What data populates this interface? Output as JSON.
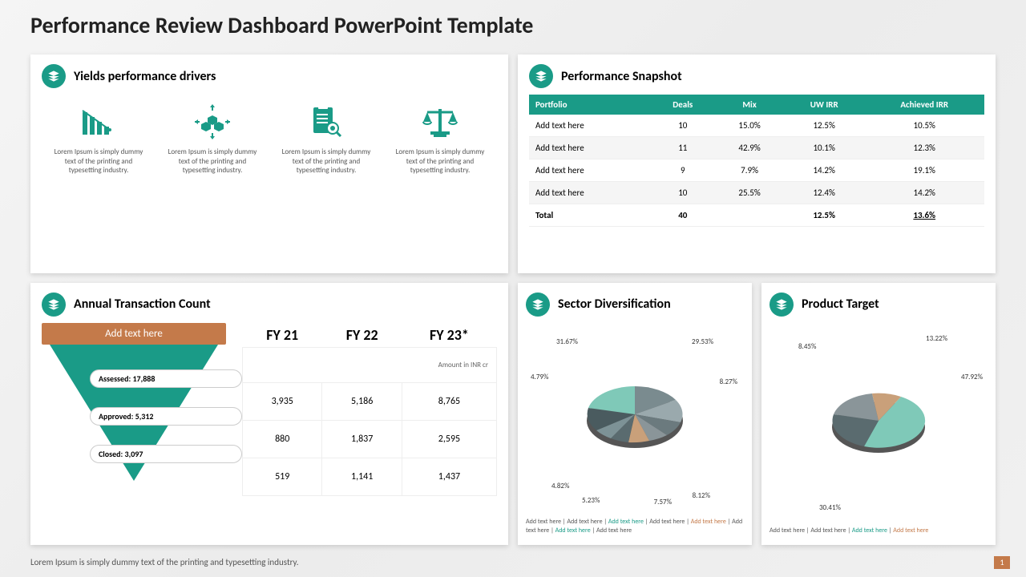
{
  "title": "Performance Review Dashboard PowerPoint Template",
  "footer": "Lorem Ipsum is simply dummy text of the printing and typesetting industry.",
  "page_num": "1",
  "drivers": {
    "title": "Yields performance drivers",
    "items": [
      {
        "text": "Lorem Ipsum is simply dummy text of the printing and typesetting industry."
      },
      {
        "text": "Lorem Ipsum is simply dummy text of the printing and typesetting industry."
      },
      {
        "text": "Lorem Ipsum is simply dummy text of the printing and typesetting industry."
      },
      {
        "text": "Lorem Ipsum is simply dummy text of the printing and typesetting industry."
      }
    ]
  },
  "snapshot": {
    "title": "Performance Snapshot",
    "headers": [
      "Portfolio",
      "Deals",
      "Mix",
      "UW IRR",
      "Achieved IRR"
    ],
    "rows": [
      {
        "portfolio": "Add text here",
        "deals": "10",
        "mix": "15.0%",
        "uw": "12.5%",
        "ach": "10.5%"
      },
      {
        "portfolio": "Add text here",
        "deals": "11",
        "mix": "42.9%",
        "uw": "10.1%",
        "ach": "12.3%"
      },
      {
        "portfolio": "Add text here",
        "deals": "9",
        "mix": "7.9%",
        "uw": "14.2%",
        "ach": "19.1%"
      },
      {
        "portfolio": "Add text here",
        "deals": "10",
        "mix": "25.5%",
        "uw": "12.4%",
        "ach": "14.2%"
      }
    ],
    "total": {
      "portfolio": "Total",
      "deals": "40",
      "mix": "",
      "uw": "12.5%",
      "ach": "13.6%"
    }
  },
  "annual": {
    "title": "Annual Transaction Count",
    "funnel_top": "Add text here",
    "stages": [
      {
        "label": "Assessed:",
        "value": "17,888"
      },
      {
        "label": "Approved:",
        "value": "5,312"
      },
      {
        "label": "Closed:",
        "value": "3,097"
      }
    ],
    "years": [
      "FY 21",
      "FY 22",
      "FY 23*"
    ],
    "subhead": "Amount in INR  cr",
    "rows": [
      [
        "3,935",
        "5,186",
        "8,765"
      ],
      [
        "880",
        "1,837",
        "2,595"
      ],
      [
        "519",
        "1,141",
        "1,437"
      ]
    ]
  },
  "sector": {
    "title": "Sector Diversification",
    "legend": "Add text here | Add text here | Add text here | Add text here | Add text here | Add text here | Add text here | Add text here",
    "labels": [
      "31.67%",
      "29.53%",
      "8.27%",
      "8.12%",
      "7.57%",
      "5.23%",
      "4.82%",
      "4.79%"
    ]
  },
  "product": {
    "title": "Product Target",
    "legend": "Add text here | Add text here | Add text here | Add text here",
    "labels": [
      "13.22%",
      "8.45%",
      "47.92%",
      "30.41%"
    ]
  },
  "chart_data": [
    {
      "type": "pie",
      "title": "Sector Diversification",
      "series": [
        {
          "name": "Sector",
          "values": [
            31.67,
            29.53,
            8.27,
            8.12,
            7.57,
            5.23,
            4.82,
            4.79
          ]
        }
      ],
      "categories": [
        "Add text here",
        "Add text here",
        "Add text here",
        "Add text here",
        "Add text here",
        "Add text here",
        "Add text here",
        "Add text here"
      ]
    },
    {
      "type": "pie",
      "title": "Product Target",
      "series": [
        {
          "name": "Product",
          "values": [
            47.92,
            30.41,
            13.22,
            8.45
          ]
        }
      ],
      "categories": [
        "Add text here",
        "Add text here",
        "Add text here",
        "Add text here"
      ]
    },
    {
      "type": "table",
      "title": "Annual Transaction Count",
      "categories": [
        "FY 21",
        "FY 22",
        "FY 23*"
      ],
      "series": [
        {
          "name": "Assessed",
          "values": [
            3935,
            5186,
            8765
          ]
        },
        {
          "name": "Approved",
          "values": [
            880,
            1837,
            2595
          ]
        },
        {
          "name": "Closed",
          "values": [
            519,
            1141,
            1437
          ]
        }
      ]
    }
  ]
}
